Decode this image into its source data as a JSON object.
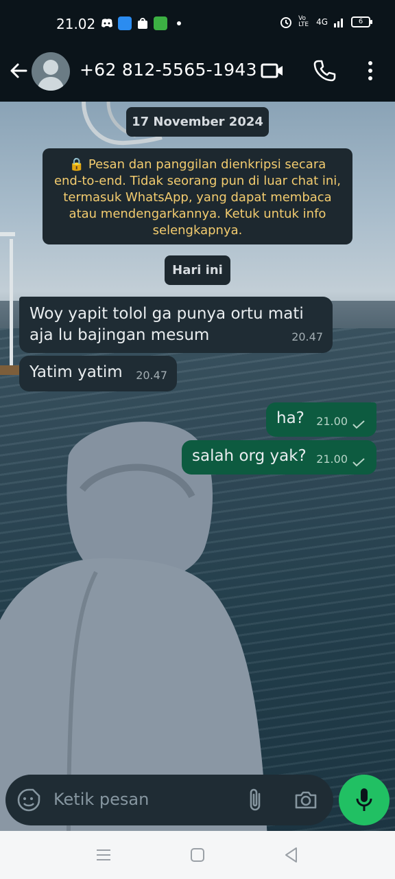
{
  "status_bar": {
    "time": "21.02",
    "battery": "6",
    "network": "4G",
    "volte": "Vo LTE"
  },
  "header": {
    "contact": "+62 812-5565-1943"
  },
  "chat": {
    "date_pill": "17 November 2024",
    "encryption_notice": "🔒 Pesan dan panggilan dienkripsi secara end-to-end. Tidak seorang pun di luar chat ini, termasuk WhatsApp, yang dapat membaca atau mendengarkannya. Ketuk untuk info selengkapnya.",
    "today_pill": "Hari ini",
    "messages": [
      {
        "direction": "incoming",
        "text": "Woy yapit tolol ga punya ortu mati aja lu bajingan mesum",
        "time": "20.47"
      },
      {
        "direction": "incoming",
        "text": "Yatim yatim",
        "time": "20.47"
      },
      {
        "direction": "outgoing",
        "text": "ha?",
        "time": "21.00",
        "status": "sent"
      },
      {
        "direction": "outgoing",
        "text": "salah org yak?",
        "time": "21.00",
        "status": "sent"
      }
    ]
  },
  "input": {
    "placeholder": "Ketik pesan"
  },
  "colors": {
    "incoming_bubble": "#1f2c34",
    "outgoing_bubble": "#0d5b40",
    "mic_button": "#21c063",
    "notice_text": "#f3cc6f"
  },
  "icons": [
    "back-arrow-icon",
    "avatar",
    "video-call-icon",
    "phone-call-icon",
    "more-menu-icon",
    "sticker-icon",
    "attach-icon",
    "camera-icon",
    "mic-icon",
    "check-icon"
  ]
}
